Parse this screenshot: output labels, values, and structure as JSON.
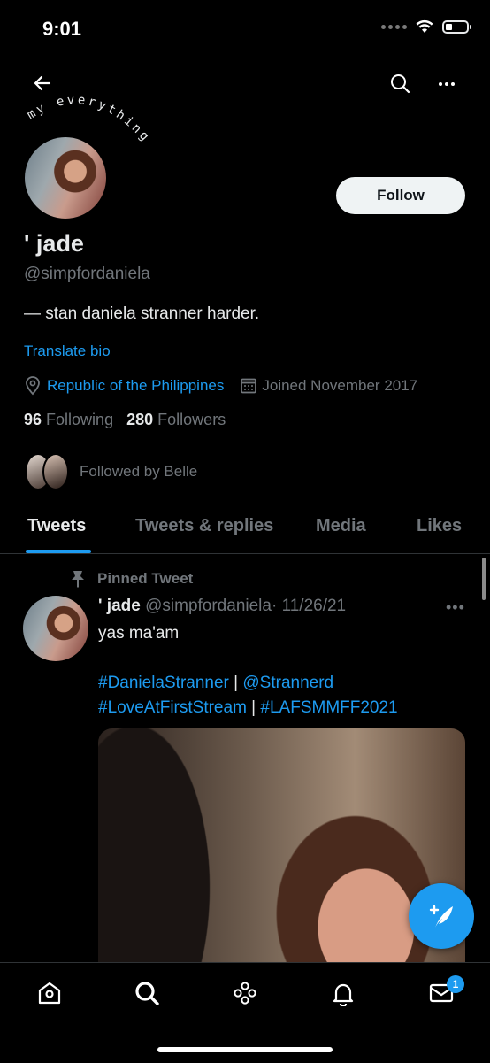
{
  "status_bar": {
    "time": "9:01"
  },
  "header": {
    "back_icon": "arrow-left-icon",
    "search_icon": "search-icon",
    "more_icon": "more-icon"
  },
  "profile": {
    "banner_text": "my everything",
    "name": "' jade",
    "handle": "@simpfordaniela",
    "bio": "— stan daniela stranner harder.",
    "translate_bio": "Translate bio",
    "location": "Republic of the Philippines",
    "joined": "Joined November 2017",
    "following_count": "96",
    "following_label": "Following",
    "followers_count": "280",
    "followers_label": "Followers",
    "followed_by": "Followed by Belle",
    "follow_button": "Follow"
  },
  "tabs": [
    {
      "label": "Tweets",
      "active": true
    },
    {
      "label": "Tweets & replies",
      "active": false
    },
    {
      "label": "Media",
      "active": false
    },
    {
      "label": "Likes",
      "active": false
    }
  ],
  "pinned_tweet": {
    "pinned_label": "Pinned Tweet",
    "author_name": "' jade",
    "author_handle": "@simpfordaniela",
    "date": "· 11/26/21",
    "text": "yas ma'am",
    "tag1": "#DanielaStranner",
    "sep1": " | ",
    "tag2": "@Strannerd",
    "tag3": "#LoveAtFirstStream",
    "sep2": " | ",
    "tag4": "#LAFSMMFF2021",
    "more": "•••"
  },
  "bottom_nav": {
    "items": [
      "home-icon",
      "search-icon",
      "spaces-icon",
      "notifications-icon",
      "messages-icon"
    ],
    "messages_badge": "1"
  },
  "colors": {
    "accent": "#1d9bf0",
    "background": "#000000",
    "muted": "#71767b"
  }
}
